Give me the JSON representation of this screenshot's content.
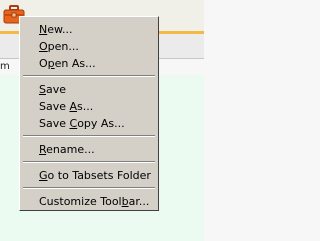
{
  "toolbar": {
    "icon": "briefcase-icon",
    "accent_color": "#f4b844"
  },
  "tabstrip": {
    "partial_label": "m"
  },
  "menu": {
    "items": [
      {
        "label": "New...",
        "mnemonic": "N"
      },
      {
        "label": "Open...",
        "mnemonic": "O"
      },
      {
        "label": "Open As...",
        "mnemonic": "p"
      },
      {
        "label": "Save",
        "mnemonic": "S"
      },
      {
        "label": "Save As...",
        "mnemonic": "A"
      },
      {
        "label": "Save Copy As...",
        "mnemonic": "C"
      },
      {
        "label": "Rename...",
        "mnemonic": "R"
      },
      {
        "label": "Go to Tabsets Folder",
        "mnemonic": "G"
      },
      {
        "label": "Customize Toolbar...",
        "mnemonic": "b"
      }
    ]
  }
}
